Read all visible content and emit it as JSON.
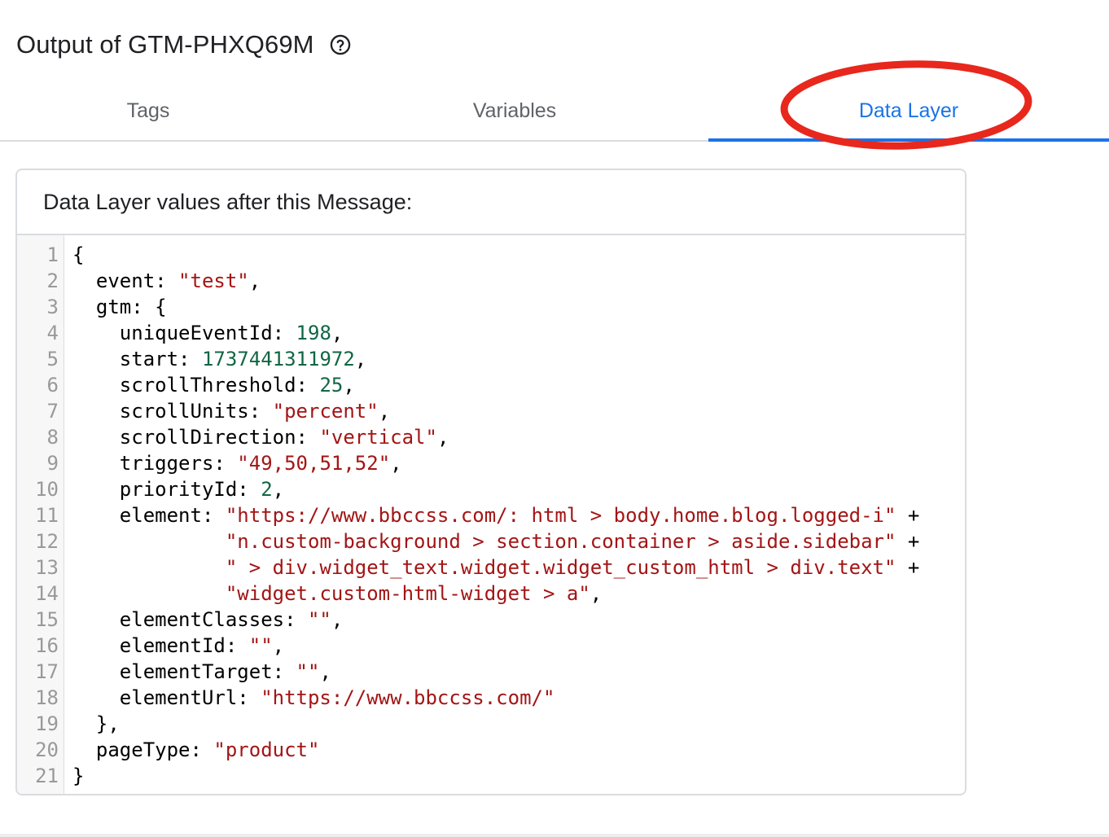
{
  "header": {
    "title": "Output of GTM-PHXQ69M",
    "help_icon": "help-circle-icon"
  },
  "tabs": [
    {
      "label": "Tags",
      "active": false
    },
    {
      "label": "Variables",
      "active": false
    },
    {
      "label": "Data Layer",
      "active": true
    }
  ],
  "colors": {
    "accent": "#1a73e8",
    "annotation_circle": "#e8271d",
    "string": "#a31515",
    "number": "#116644"
  },
  "card": {
    "heading": "Data Layer values after this Message:"
  },
  "code_lines": [
    [
      {
        "t": "{",
        "k": "punct"
      }
    ],
    [
      {
        "t": "  event: ",
        "k": "key"
      },
      {
        "t": "\"test\"",
        "k": "str"
      },
      {
        "t": ",",
        "k": "punct"
      }
    ],
    [
      {
        "t": "  gtm: {",
        "k": "key"
      }
    ],
    [
      {
        "t": "    uniqueEventId: ",
        "k": "key"
      },
      {
        "t": "198",
        "k": "num"
      },
      {
        "t": ",",
        "k": "punct"
      }
    ],
    [
      {
        "t": "    start: ",
        "k": "key"
      },
      {
        "t": "1737441311972",
        "k": "num"
      },
      {
        "t": ",",
        "k": "punct"
      }
    ],
    [
      {
        "t": "    scrollThreshold: ",
        "k": "key"
      },
      {
        "t": "25",
        "k": "num"
      },
      {
        "t": ",",
        "k": "punct"
      }
    ],
    [
      {
        "t": "    scrollUnits: ",
        "k": "key"
      },
      {
        "t": "\"percent\"",
        "k": "str"
      },
      {
        "t": ",",
        "k": "punct"
      }
    ],
    [
      {
        "t": "    scrollDirection: ",
        "k": "key"
      },
      {
        "t": "\"vertical\"",
        "k": "str"
      },
      {
        "t": ",",
        "k": "punct"
      }
    ],
    [
      {
        "t": "    triggers: ",
        "k": "key"
      },
      {
        "t": "\"49,50,51,52\"",
        "k": "str"
      },
      {
        "t": ",",
        "k": "punct"
      }
    ],
    [
      {
        "t": "    priorityId: ",
        "k": "key"
      },
      {
        "t": "2",
        "k": "num"
      },
      {
        "t": ",",
        "k": "punct"
      }
    ],
    [
      {
        "t": "    element: ",
        "k": "key"
      },
      {
        "t": "\"https://www.bbccss.com/: html > body.home.blog.logged-i\"",
        "k": "str"
      },
      {
        "t": " +",
        "k": "punct"
      }
    ],
    [
      {
        "t": "             ",
        "k": "key"
      },
      {
        "t": "\"n.custom-background > section.container > aside.sidebar\"",
        "k": "str"
      },
      {
        "t": " +",
        "k": "punct"
      }
    ],
    [
      {
        "t": "             ",
        "k": "key"
      },
      {
        "t": "\" > div.widget_text.widget.widget_custom_html > div.text\"",
        "k": "str"
      },
      {
        "t": " +",
        "k": "punct"
      }
    ],
    [
      {
        "t": "             ",
        "k": "key"
      },
      {
        "t": "\"widget.custom-html-widget > a\"",
        "k": "str"
      },
      {
        "t": ",",
        "k": "punct"
      }
    ],
    [
      {
        "t": "    elementClasses: ",
        "k": "key"
      },
      {
        "t": "\"\"",
        "k": "str"
      },
      {
        "t": ",",
        "k": "punct"
      }
    ],
    [
      {
        "t": "    elementId: ",
        "k": "key"
      },
      {
        "t": "\"\"",
        "k": "str"
      },
      {
        "t": ",",
        "k": "punct"
      }
    ],
    [
      {
        "t": "    elementTarget: ",
        "k": "key"
      },
      {
        "t": "\"\"",
        "k": "str"
      },
      {
        "t": ",",
        "k": "punct"
      }
    ],
    [
      {
        "t": "    elementUrl: ",
        "k": "key"
      },
      {
        "t": "\"https://www.bbccss.com/\"",
        "k": "str"
      }
    ],
    [
      {
        "t": "  },",
        "k": "key"
      }
    ],
    [
      {
        "t": "  pageType: ",
        "k": "key"
      },
      {
        "t": "\"product\"",
        "k": "str"
      }
    ],
    [
      {
        "t": "}",
        "k": "punct"
      }
    ]
  ]
}
